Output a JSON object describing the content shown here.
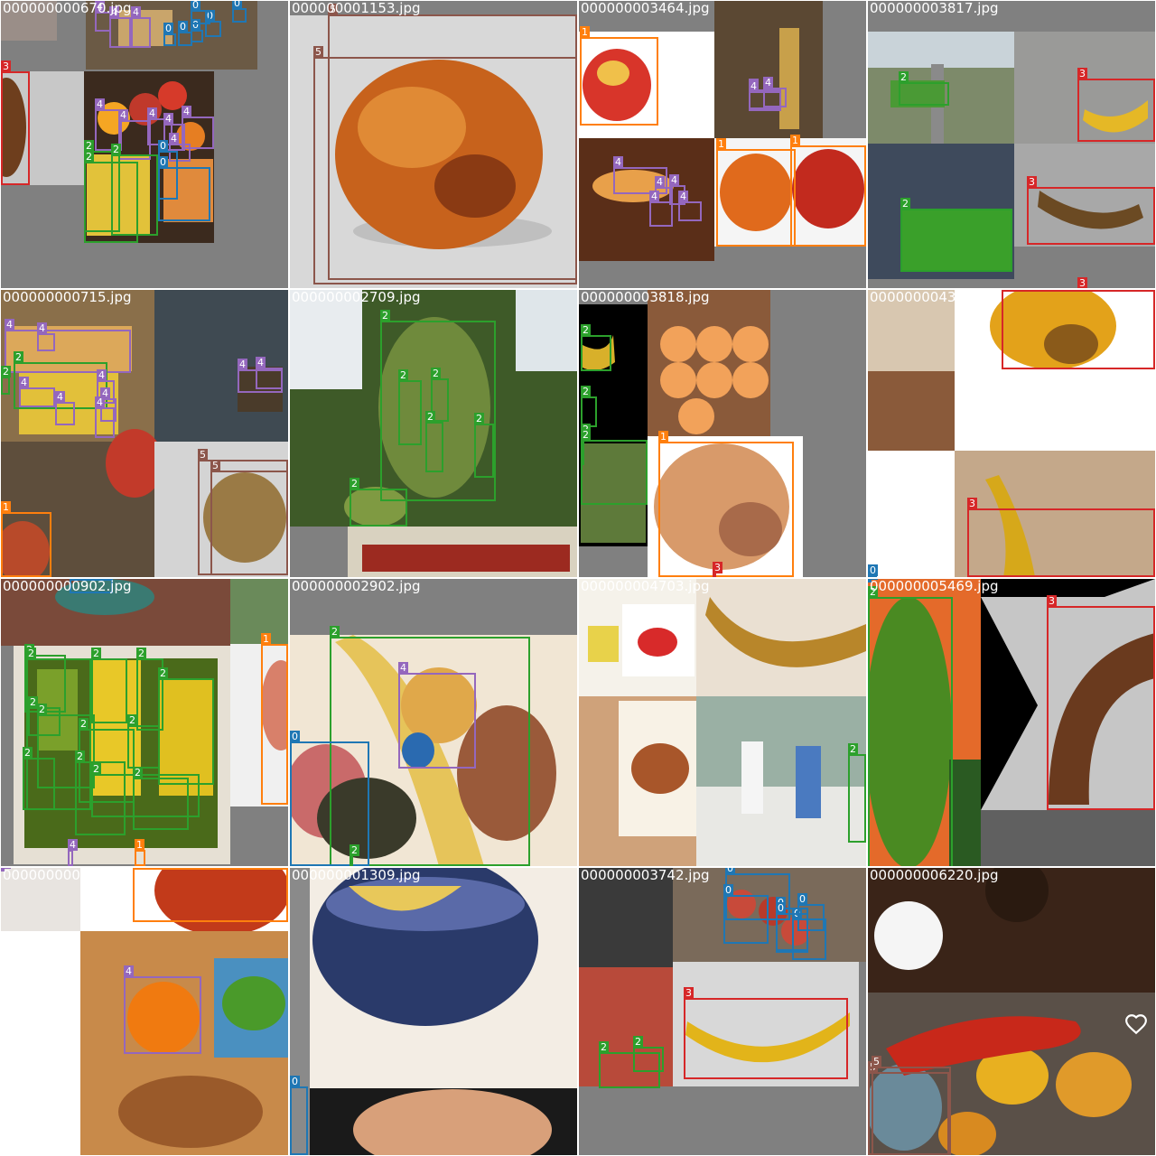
{
  "class_colors": {
    "0": "#1f77b4",
    "1": "#ff7f0e",
    "2": "#2ca02c",
    "3": "#d62728",
    "4": "#9467bd",
    "5": "#8c564b"
  },
  "tiles": [
    {
      "filename": "000000000670.jpg",
      "boxes": [
        {
          "c": "4"
        },
        {
          "c": "4"
        },
        {
          "c": "4"
        },
        {
          "c": "0"
        },
        {
          "c": "0"
        },
        {
          "c": "0"
        },
        {
          "c": "0"
        },
        {
          "c": "0"
        },
        {
          "c": "0"
        },
        {
          "c": "3"
        },
        {
          "c": "4"
        },
        {
          "c": "4"
        },
        {
          "c": "4"
        },
        {
          "c": "4"
        },
        {
          "c": "4"
        },
        {
          "c": "4"
        },
        {
          "c": "2"
        },
        {
          "c": "2"
        },
        {
          "c": "2"
        },
        {
          "c": "0"
        },
        {
          "c": "0"
        }
      ]
    },
    {
      "filename": "000000001153.jpg",
      "boxes": [
        {
          "c": "5"
        },
        {
          "c": "5"
        }
      ]
    },
    {
      "filename": "000000003464.jpg",
      "boxes": [
        {
          "c": "1"
        },
        {
          "c": "4"
        },
        {
          "c": "4"
        },
        {
          "c": "4"
        },
        {
          "c": "4"
        },
        {
          "c": "4"
        },
        {
          "c": "4"
        },
        {
          "c": "4"
        },
        {
          "c": "4"
        },
        {
          "c": "1"
        },
        {
          "c": "1"
        }
      ]
    },
    {
      "filename": "000000003817.jpg",
      "boxes": [
        {
          "c": "2"
        },
        {
          "c": "3"
        },
        {
          "c": "3"
        },
        {
          "c": "2"
        },
        {
          "c": "3"
        }
      ]
    },
    {
      "filename": "000000000715.jpg",
      "boxes": [
        {
          "c": "4"
        },
        {
          "c": "4"
        },
        {
          "c": "2"
        },
        {
          "c": "4"
        },
        {
          "c": "4"
        },
        {
          "c": "2"
        },
        {
          "c": "4"
        },
        {
          "c": "4"
        },
        {
          "c": "4"
        },
        {
          "c": "4"
        },
        {
          "c": "4"
        },
        {
          "c": "5"
        },
        {
          "c": "5"
        },
        {
          "c": "1"
        }
      ]
    },
    {
      "filename": "000000002709.jpg",
      "boxes": [
        {
          "c": "2"
        },
        {
          "c": "2"
        },
        {
          "c": "2"
        },
        {
          "c": "2"
        },
        {
          "c": "2"
        },
        {
          "c": "2"
        }
      ]
    },
    {
      "filename": "000000003818.jpg",
      "boxes": [
        {
          "c": "2"
        },
        {
          "c": "2"
        },
        {
          "c": "2"
        },
        {
          "c": "2"
        },
        {
          "c": "1"
        },
        {
          "c": "3"
        }
      ]
    },
    {
      "filename": "000000004376.jpg",
      "boxes": [
        {
          "c": "3"
        },
        {
          "c": "3"
        },
        {
          "c": "0"
        }
      ]
    },
    {
      "filename": "000000000902.jpg",
      "boxes": [
        {
          "c": "2"
        },
        {
          "c": "0"
        },
        {
          "c": "2"
        },
        {
          "c": "2"
        },
        {
          "c": "2"
        },
        {
          "c": "2"
        },
        {
          "c": "2"
        },
        {
          "c": "2"
        },
        {
          "c": "2"
        },
        {
          "c": "2"
        },
        {
          "c": "2"
        },
        {
          "c": "2"
        },
        {
          "c": "2"
        },
        {
          "c": "2"
        },
        {
          "c": "1"
        },
        {
          "c": "4"
        },
        {
          "c": "1"
        }
      ]
    },
    {
      "filename": "000000002902.jpg",
      "boxes": [
        {
          "c": "2"
        },
        {
          "c": "4"
        },
        {
          "c": "0"
        },
        {
          "c": "2"
        }
      ]
    },
    {
      "filename": "000000004703.jpg",
      "boxes": [
        {
          "c": "2"
        }
      ]
    },
    {
      "filename": "000000005469.jpg",
      "boxes": [
        {
          "c": "2"
        },
        {
          "c": "0"
        },
        {
          "c": "3"
        }
      ]
    },
    {
      "filename": "000000000984.jpg",
      "boxes": [
        {
          "c": "4"
        },
        {
          "c": "1"
        },
        {
          "c": "4"
        }
      ]
    },
    {
      "filename": "000000001309.jpg",
      "boxes": [
        {
          "c": "0"
        }
      ]
    },
    {
      "filename": "000000003742.jpg",
      "boxes": [
        {
          "c": "0"
        },
        {
          "c": "0"
        },
        {
          "c": "0"
        },
        {
          "c": "0"
        },
        {
          "c": "0"
        },
        {
          "c": "0"
        },
        {
          "c": "3"
        },
        {
          "c": "2"
        },
        {
          "c": "2"
        }
      ]
    },
    {
      "filename": "000000006220.jpg",
      "boxes": [
        {
          "c": "5"
        },
        {
          "c": "5"
        }
      ]
    }
  ],
  "icons": {
    "heart": "heart-icon"
  }
}
